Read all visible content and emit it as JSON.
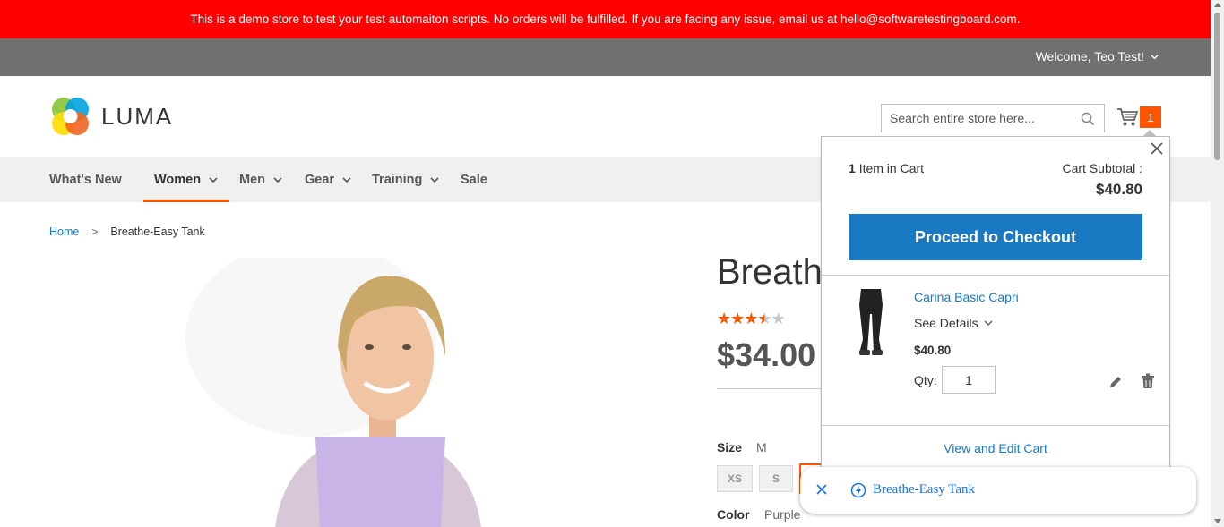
{
  "banner": {
    "text": "This is a demo store to test your test automaiton scripts. No orders will be fulfilled. If you are facing any issue, email us at hello@softwaretestingboard.com."
  },
  "topbar": {
    "welcome": "Welcome, Teo Test!"
  },
  "header": {
    "logo_text": "LUMA",
    "search_placeholder": "Search entire store here...",
    "cart_count": "1"
  },
  "nav": {
    "items": [
      {
        "label": "What's New"
      },
      {
        "label": "Women"
      },
      {
        "label": "Men"
      },
      {
        "label": "Gear"
      },
      {
        "label": "Training"
      },
      {
        "label": "Sale"
      }
    ],
    "active": "Women"
  },
  "breadcrumb": {
    "home": "Home",
    "separator": ">",
    "current": "Breathe-Easy Tank"
  },
  "product": {
    "title": "Breathe-Easy Tank",
    "rating": 3.5,
    "rating_max": 5,
    "price": "$34.00",
    "size_label": "Size",
    "size_value": "M",
    "sizes": [
      "XS",
      "S"
    ],
    "color_label": "Color",
    "color_value": "Purple"
  },
  "minicart": {
    "items_count": "1",
    "items_label": "Item in Cart",
    "subtotal_label": "Cart Subtotal :",
    "subtotal": "$40.80",
    "checkout_label": "Proceed to Checkout",
    "item": {
      "name": "Carina Basic Capri",
      "see_details": "See Details",
      "price": "$40.80",
      "qty_label": "Qty:",
      "qty": "1"
    },
    "view_cart_label": "View and Edit Cart"
  },
  "toast": {
    "text": "Breathe-Easy Tank"
  },
  "colors": {
    "banner": "#ff0000",
    "topbar": "#6e716e",
    "accent": "#ff5501",
    "primary": "#1979c3"
  }
}
